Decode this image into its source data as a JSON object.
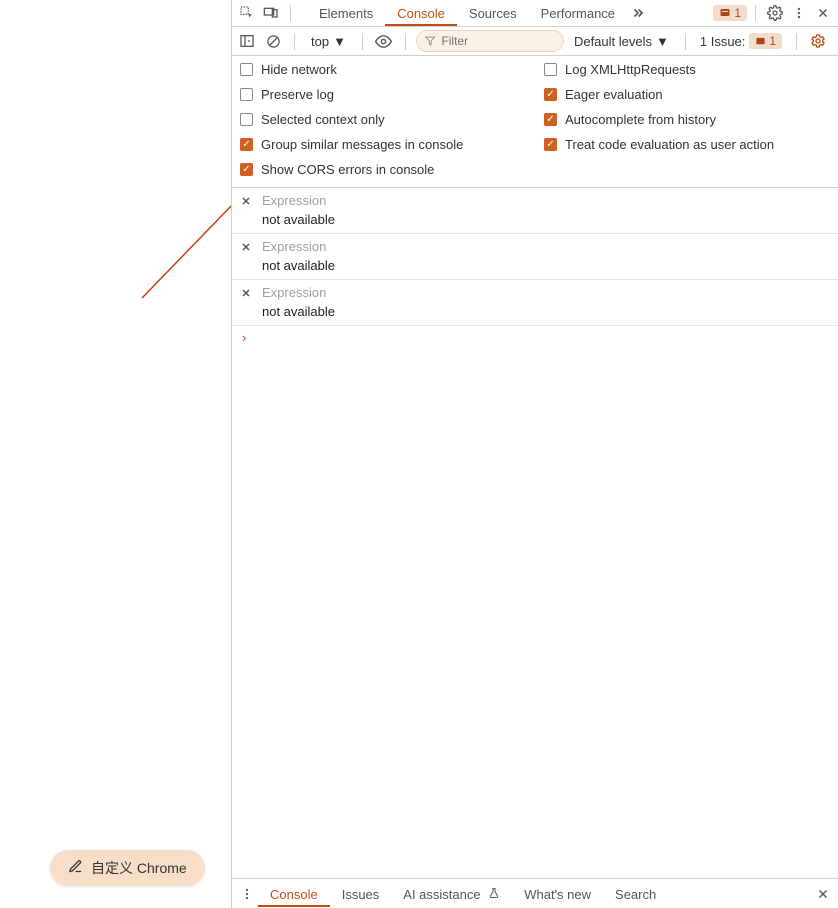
{
  "topbar": {
    "tabs": [
      "Elements",
      "Console",
      "Sources",
      "Performance"
    ],
    "activeTab": "Console",
    "msgCount": "1"
  },
  "toolbar": {
    "context": "top",
    "filterPlaceholder": "Filter",
    "levels": "Default levels",
    "issuesLabel": "1 Issue:",
    "issuesCount": "1"
  },
  "settings": {
    "left": [
      {
        "label": "Hide network",
        "checked": false
      },
      {
        "label": "Preserve log",
        "checked": false
      },
      {
        "label": "Selected context only",
        "checked": false
      },
      {
        "label": "Group similar messages in console",
        "checked": true
      },
      {
        "label": "Show CORS errors in console",
        "checked": true
      }
    ],
    "right": [
      {
        "label": "Log XMLHttpRequests",
        "checked": false
      },
      {
        "label": "Eager evaluation",
        "checked": true
      },
      {
        "label": "Autocomplete from history",
        "checked": true
      },
      {
        "label": "Treat code evaluation as user action",
        "checked": true
      }
    ]
  },
  "expressions": [
    {
      "input": "Expression",
      "result": "not available"
    },
    {
      "input": "Expression",
      "result": "not available"
    },
    {
      "input": "Expression",
      "result": "not available"
    }
  ],
  "drawer": {
    "tabs": [
      "Console",
      "Issues",
      "AI assistance",
      "What's new",
      "Search"
    ],
    "activeTab": "Console"
  },
  "chip": {
    "label": "自定义 Chrome"
  }
}
